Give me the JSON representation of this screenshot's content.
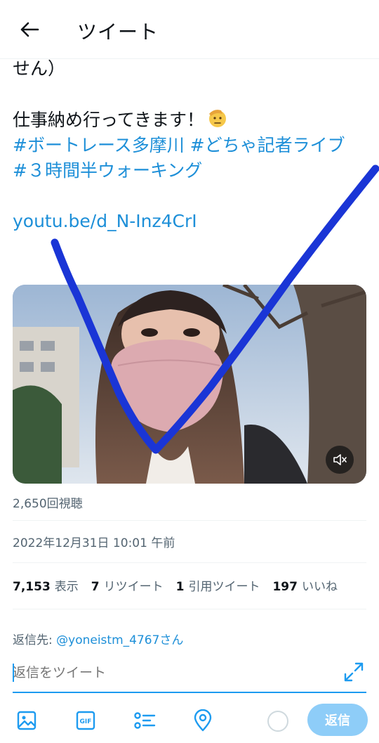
{
  "header": {
    "title": "ツイート"
  },
  "tweet": {
    "text_cont": "せん）",
    "text_main": "仕事納め行ってきます！",
    "hashtags": [
      "#ボートレース多摩川",
      "#どちゃ記者ライブ",
      "#３時間半ウォーキング"
    ],
    "link": "youtu.be/d_N-Inz4CrI",
    "views": "2,650回視聴",
    "timestamp": "2022年12月31日 10:01 午前"
  },
  "stats": {
    "impressions_count": "7,153",
    "impressions_label": "表示",
    "retweets_count": "7",
    "retweets_label": "リツイート",
    "quotes_count": "1",
    "quotes_label": "引用ツイート",
    "likes_count": "197",
    "likes_label": "いいね"
  },
  "reply": {
    "to_label": "返信先: ",
    "to_handle": "@yoneistm_4767さん",
    "placeholder": "返信をツイート",
    "button_label": "返信"
  },
  "icons": [
    "back-arrow-icon",
    "saluting-face-emoji-icon",
    "mute-icon",
    "expand-icon",
    "image-icon",
    "gif-icon",
    "poll-icon",
    "location-icon"
  ],
  "colors": {
    "accent": "#1d9bf0",
    "link": "#1d8fd8",
    "scribble": "#1a35d6",
    "reply_button": "#8ecdf8"
  }
}
